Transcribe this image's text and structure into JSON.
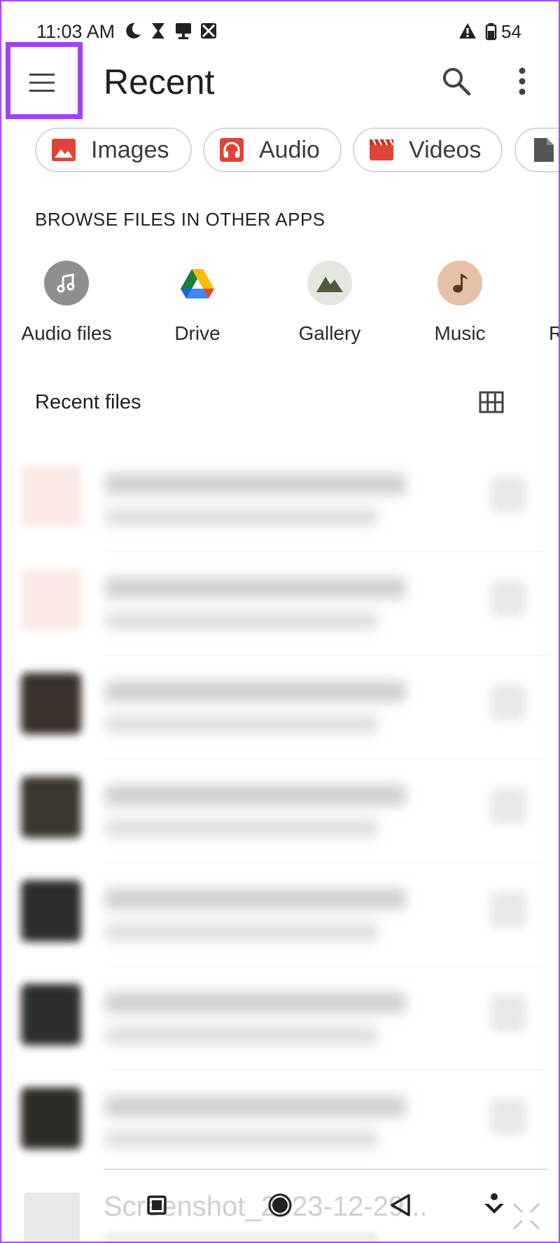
{
  "status_bar": {
    "time": "11:03 AM",
    "battery": "54"
  },
  "app_bar": {
    "title": "Recent"
  },
  "chips": [
    {
      "label": "Images",
      "icon": "image-icon"
    },
    {
      "label": "Audio",
      "icon": "headphones-icon"
    },
    {
      "label": "Videos",
      "icon": "clapperboard-icon"
    },
    {
      "label": "",
      "icon": "document-icon"
    }
  ],
  "browse": {
    "heading": "BROWSE FILES IN OTHER APPS",
    "apps": [
      {
        "label": "Audio files",
        "icon": "music-note-icon"
      },
      {
        "label": "Drive",
        "icon": "drive-icon"
      },
      {
        "label": "Gallery",
        "icon": "mountain-icon"
      },
      {
        "label": "Music",
        "icon": "music-note-icon"
      },
      {
        "label": "R",
        "icon": ""
      }
    ]
  },
  "recent_files": {
    "heading": "Recent files",
    "partial_item_name": "Screenshot_2023-12-29..."
  },
  "colors": {
    "highlight": "#a640f0",
    "chip_icon_red": "#e04436",
    "gallery_bg": "#e6e6e1",
    "gallery_fg": "#4f5a3a",
    "music_bg": "#e6c0a6",
    "music_fg": "#5b3a1e",
    "audio_files_bg": "#8f8f8f"
  }
}
